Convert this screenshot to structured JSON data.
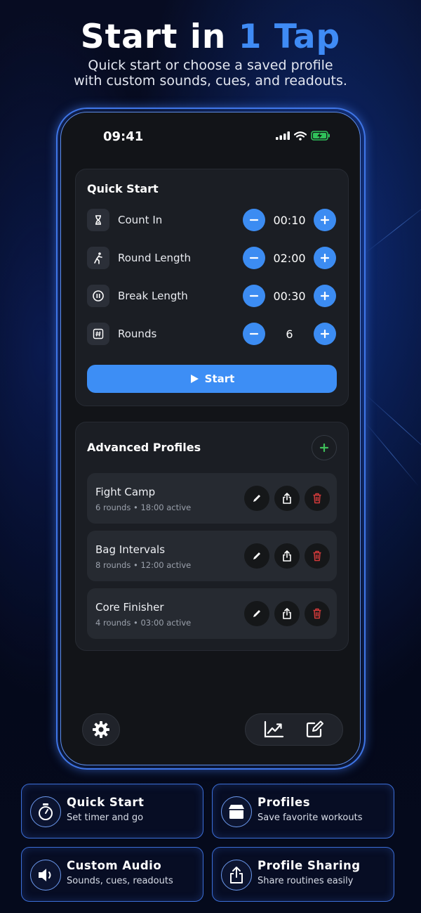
{
  "headline": {
    "prefix": "Start in ",
    "accent": "1 Tap"
  },
  "subline": {
    "line1": "Quick start or choose a saved profile",
    "line2": "with custom sounds, cues, and readouts."
  },
  "status_bar": {
    "time": "09:41",
    "battery_color": "#30c15a"
  },
  "quick_start": {
    "title": "Quick Start",
    "rows": [
      {
        "label": "Count In",
        "value": "00:10",
        "icon": "hourglass-icon"
      },
      {
        "label": "Round Length",
        "value": "02:00",
        "icon": "runner-icon"
      },
      {
        "label": "Break Length",
        "value": "00:30",
        "icon": "pause-circle-icon"
      },
      {
        "label": "Rounds",
        "value": "6",
        "icon": "hash-icon"
      }
    ],
    "start_label": "Start"
  },
  "advanced_profiles": {
    "title": "Advanced Profiles",
    "profiles": [
      {
        "name": "Fight Camp",
        "meta": "6 rounds • 18:00 active"
      },
      {
        "name": "Bag Intervals",
        "meta": "8 rounds • 12:00 active"
      },
      {
        "name": "Core Finisher",
        "meta": "4 rounds • 03:00 active"
      }
    ]
  },
  "features": [
    {
      "title": "Quick Start",
      "subtitle": "Set timer and go",
      "icon": "stopwatch-icon"
    },
    {
      "title": "Profiles",
      "subtitle": "Save favorite workouts",
      "icon": "box-icon"
    },
    {
      "title": "Custom Audio",
      "subtitle": "Sounds, cues, readouts",
      "icon": "speaker-icon"
    },
    {
      "title": "Profile Sharing",
      "subtitle": "Share routines easily",
      "icon": "share-icon"
    }
  ],
  "colors": {
    "accent": "#3d8ef5",
    "add": "#3fbf5a",
    "delete": "#d23a3a",
    "tile_border": "#3b6ed8"
  }
}
